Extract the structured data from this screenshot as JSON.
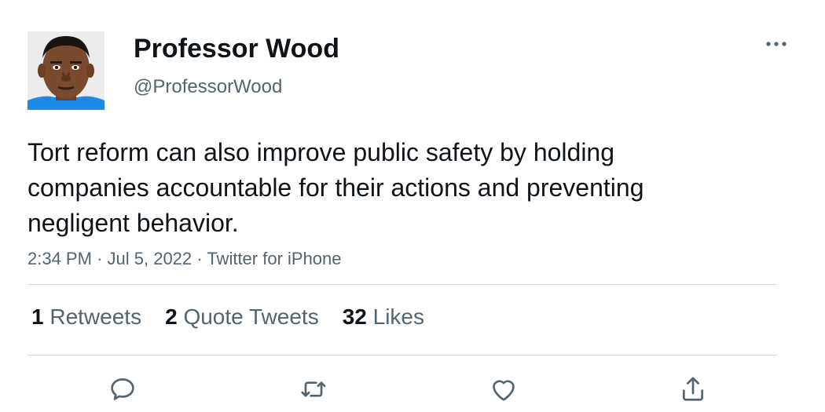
{
  "author": {
    "display_name": "Professor Wood",
    "handle": "@ProfessorWood",
    "avatar_icon": "profile-photo"
  },
  "tweet": {
    "text": "Tort reform can also improve public safety by holding companies accountable for their actions and preventing negligent behavior.",
    "time": "2:34 PM",
    "separator": "·",
    "date": "Jul 5, 2022",
    "source": "Twitter for iPhone"
  },
  "stats": {
    "retweets_count": "1",
    "retweets_label": "Retweets",
    "quotes_count": "2",
    "quotes_label": "Quote Tweets",
    "likes_count": "32",
    "likes_label": "Likes"
  },
  "actions": {
    "icons": [
      "reply-icon",
      "retweet-icon",
      "like-icon",
      "share-icon"
    ],
    "icon_color": "#536471"
  },
  "colors": {
    "text_primary": "#0f1419",
    "text_secondary": "#536471",
    "divider": "#cfd9de"
  }
}
